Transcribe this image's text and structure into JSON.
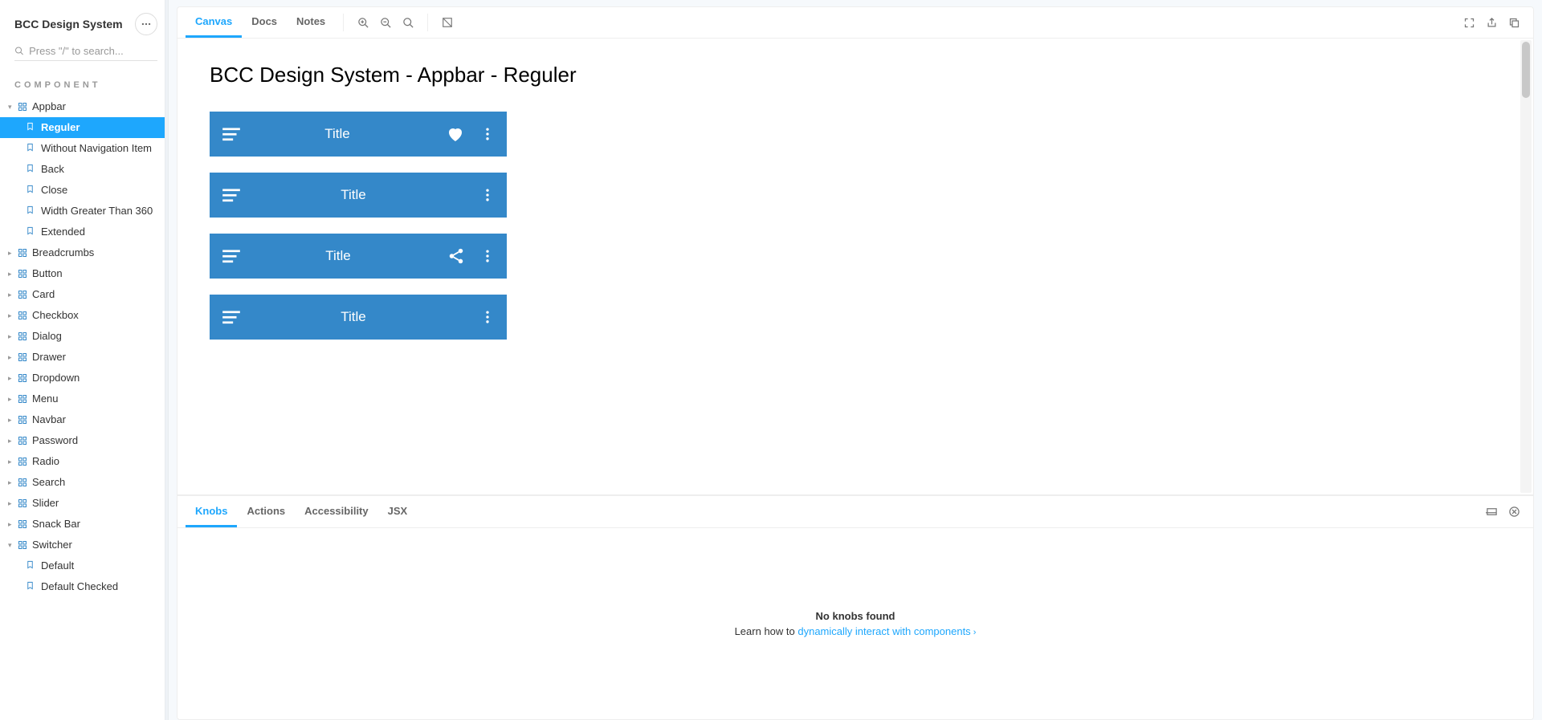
{
  "sidebar": {
    "title": "BCC Design System",
    "search_placeholder": "Press \"/\" to search...",
    "section_label": "COMPONENT",
    "items": [
      {
        "label": "Appbar",
        "expanded": true,
        "children": [
          {
            "label": "Reguler",
            "active": true
          },
          {
            "label": "Without Navigation Item"
          },
          {
            "label": "Back"
          },
          {
            "label": "Close"
          },
          {
            "label": "Width Greater Than 360"
          },
          {
            "label": "Extended"
          }
        ]
      },
      {
        "label": "Breadcrumbs"
      },
      {
        "label": "Button"
      },
      {
        "label": "Card"
      },
      {
        "label": "Checkbox"
      },
      {
        "label": "Dialog"
      },
      {
        "label": "Drawer"
      },
      {
        "label": "Dropdown"
      },
      {
        "label": "Menu"
      },
      {
        "label": "Navbar"
      },
      {
        "label": "Password"
      },
      {
        "label": "Radio"
      },
      {
        "label": "Search"
      },
      {
        "label": "Slider"
      },
      {
        "label": "Snack Bar"
      },
      {
        "label": "Switcher",
        "expanded": true,
        "children": [
          {
            "label": "Default"
          },
          {
            "label": "Default Checked"
          }
        ]
      }
    ]
  },
  "toolbar": {
    "tabs": [
      {
        "label": "Canvas",
        "active": true
      },
      {
        "label": "Docs"
      },
      {
        "label": "Notes"
      }
    ]
  },
  "canvas": {
    "heading": "BCC Design System - Appbar - Reguler",
    "appbars": [
      {
        "title": "Title",
        "action": "heart"
      },
      {
        "title": "Title",
        "action": null
      },
      {
        "title": "Title",
        "action": "share"
      },
      {
        "title": "Title",
        "action": null
      }
    ]
  },
  "addons": {
    "tabs": [
      {
        "label": "Knobs",
        "active": true
      },
      {
        "label": "Actions"
      },
      {
        "label": "Accessibility"
      },
      {
        "label": "JSX"
      }
    ],
    "empty_title": "No knobs found",
    "empty_prefix": "Learn how to ",
    "empty_link": "dynamically interact with components"
  }
}
